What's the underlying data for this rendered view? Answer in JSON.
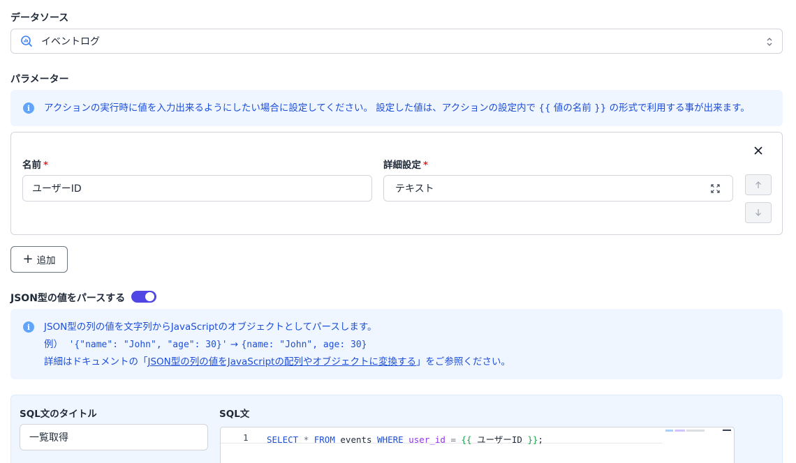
{
  "datasource": {
    "label": "データソース",
    "selected": "イベントログ",
    "icon": "search-chart-icon"
  },
  "parameters": {
    "label": "パラメーター",
    "info": "アクションの実行時に値を入力出来るようにしたい場合に設定してください。 設定した値は、アクションの設定内で {{ 値の名前 }} の形式で利用する事が出来ます。",
    "item": {
      "name_label": "名前",
      "name_value": "ユーザーID",
      "detail_label": "詳細設定",
      "detail_value": "テキスト",
      "required_mark": "*"
    },
    "add_label": "追加"
  },
  "json_parse": {
    "label": "JSON型の値をパースする",
    "enabled": true,
    "info_line1": "JSON型の列の値を文字列からJavaScriptのオブジェクトとしてパースします。",
    "info_line2_prefix": "例）",
    "info_line2_from": "'{\"name\": \"John\", \"age\": 30}'",
    "info_line2_arrow": "→",
    "info_line2_to": "{name: \"John\", age: 30}",
    "info_line3_prefix": "詳細はドキュメントの「",
    "info_line3_link": "JSON型の列の値をJavaScriptの配列やオブジェクトに変換する",
    "info_line3_suffix": "」をご参照ください。"
  },
  "sql": {
    "title_label": "SQL文のタイトル",
    "title_value": "一覧取得",
    "sql_label": "SQL文",
    "line_number": "1",
    "tokens": {
      "select": "SELECT",
      "star": "*",
      "from": "FROM",
      "table": "events",
      "where": "WHERE",
      "column": "user_id",
      "eq": "=",
      "open": "{{",
      "param": "ユーザーID",
      "close": "}}",
      "semi": ";"
    }
  },
  "colors": {
    "accent": "#4f46e5",
    "info_bg": "#eff6ff",
    "info_text": "#1d4ed8",
    "required": "#dc2626"
  }
}
